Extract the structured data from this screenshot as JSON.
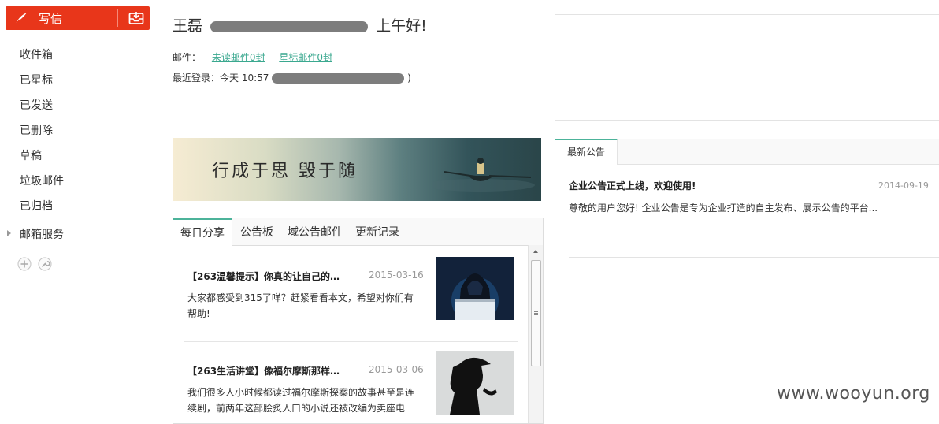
{
  "sidebar": {
    "compose_label": "写信",
    "items": [
      {
        "label": "收件箱"
      },
      {
        "label": "已星标"
      },
      {
        "label": "已发送"
      },
      {
        "label": "已删除"
      },
      {
        "label": "草稿"
      },
      {
        "label": "垃圾邮件"
      },
      {
        "label": "已归档"
      },
      {
        "label": "邮箱服务"
      }
    ]
  },
  "greeting": {
    "name": "王磊",
    "suffix": "上午好!"
  },
  "mail_summary": {
    "prefix": "邮件：",
    "unread": "未读邮件0封",
    "starred": "星标邮件0封"
  },
  "last_login": {
    "label": "最近登录：今天 10:57",
    "tail": ")"
  },
  "banner": {
    "text": "行成于思  毁于随"
  },
  "tabs": [
    "每日分享",
    "公告板",
    "域公告邮件",
    "更新记录"
  ],
  "articles": [
    {
      "title": "【263温馨提示】你真的让自己的…",
      "date": "2015-03-16",
      "body": "大家都感受到315了咩？赶紧看看本文，希望对你们有帮助!"
    },
    {
      "title": "【263生活讲堂】像福尔摩斯那样…",
      "date": "2015-03-06",
      "body": "我们很多人小时候都读过福尔摩斯探案的故事甚至是连续剧，前两年这部脍炙人口的小说还被改编为卖座电"
    }
  ],
  "notice": {
    "tab_label": "最新公告",
    "title": "企业公告正式上线，欢迎使用!",
    "date": "2014-09-19",
    "body": "尊敬的用户您好! 企业公告是专为企业打造的自主发布、展示公告的平台..."
  },
  "watermark": "www.wooyun.org",
  "colors": {
    "accent": "#e8361a",
    "link": "#3aa88f",
    "tab_active": "#4cb39a"
  }
}
